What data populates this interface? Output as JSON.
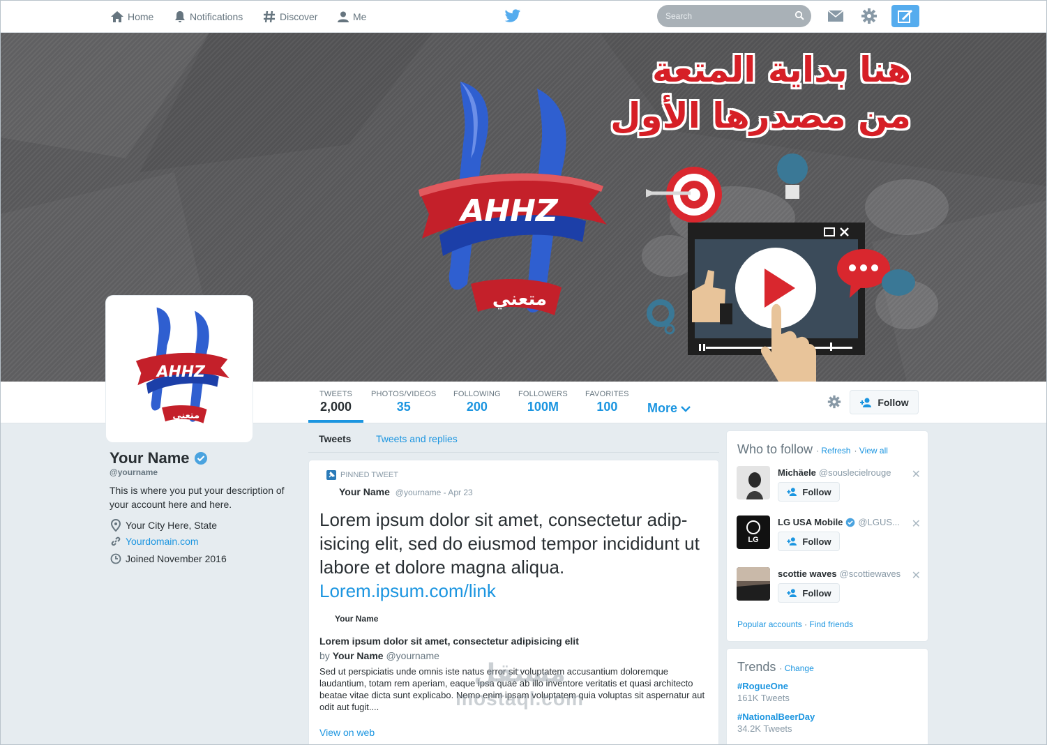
{
  "nav": {
    "home": "Home",
    "notifications": "Notifications",
    "discover": "Discover",
    "me": "Me",
    "search_placeholder": "Search"
  },
  "banner": {
    "arabic_line1": "هنا بداية المتعة",
    "arabic_line2": "من مصدرها الأول",
    "logo_text": "AHHZ",
    "logo_arabic": "متعني"
  },
  "stats": [
    {
      "label": "TWEETS",
      "value": "2,000"
    },
    {
      "label": "PHOTOS/VIDEOS",
      "value": "35"
    },
    {
      "label": "FOLLOWING",
      "value": "200"
    },
    {
      "label": "FOLLOWERS",
      "value": "100M"
    },
    {
      "label": "FAVORITES",
      "value": "100"
    }
  ],
  "more_label": "More",
  "follow_label": "Follow",
  "profile": {
    "name": "Your Name",
    "handle": "@yourname",
    "bio": "This is where you put your description of your account here and here.",
    "location": "Your City Here, State",
    "website": "Yourdomain.com",
    "joined": "Joined November 2016"
  },
  "tabs": {
    "tweets": "Tweets",
    "replies": "Tweets and replies"
  },
  "tweet": {
    "pinned_label": "PINNED TWEET",
    "author": "Your Name",
    "meta": "@yourname - Apr 23",
    "text": "Lorem ipsum dolor sit amet, consectetur adip-isicing elit, sed do eiusmod tempor incididunt ut labore et dolore magna aliqua.",
    "link": "Lorem.ipsum.com/link",
    "card_site": "Your Name",
    "card_title": "Lorem ipsum dolor sit amet, consectetur adipisicing elit",
    "card_by_prefix": "by",
    "card_by_name": "Your Name",
    "card_by_handle": "@yourname",
    "card_desc": "Sed ut perspiciatis unde omnis iste natus error sit voluptatem accusantium doloremque laudantium, totam rem aperiam, eaque ipsa quae ab illo inventore veritatis et quasi architecto beatae vitae dicta sunt explicabo. Nemo enim ipsam voluptatem quia voluptas sit aspernatur aut odit aut fugit....",
    "view_on_web": "View on web"
  },
  "who_to_follow": {
    "title": "Who to follow",
    "refresh": "Refresh",
    "view_all": "View all",
    "suggestions": [
      {
        "name": "Michäele",
        "handle": "@souslecielrouge",
        "follow": "Follow"
      },
      {
        "name": "LG USA Mobile",
        "handle": "@LGUS...",
        "follow": "Follow",
        "avatar_text": "LG"
      },
      {
        "name": "scottie waves",
        "handle": "@scottiewaves",
        "follow": "Follow"
      }
    ],
    "popular": "Popular accounts",
    "find_friends": "Find friends"
  },
  "trends": {
    "title": "Trends",
    "change": "Change",
    "items": [
      {
        "tag": "#RogueOne",
        "count": "161K Tweets"
      },
      {
        "tag": "#NationalBeerDay",
        "count": "34.2K Tweets"
      }
    ]
  },
  "watermark": {
    "ar": "مستقل",
    "en": "mostaql.com"
  },
  "colors": {
    "accent": "#1b95e0",
    "twitter_blue": "#55acee",
    "brand_red": "#d61f26",
    "logo_blue": "#2f5fd0"
  }
}
